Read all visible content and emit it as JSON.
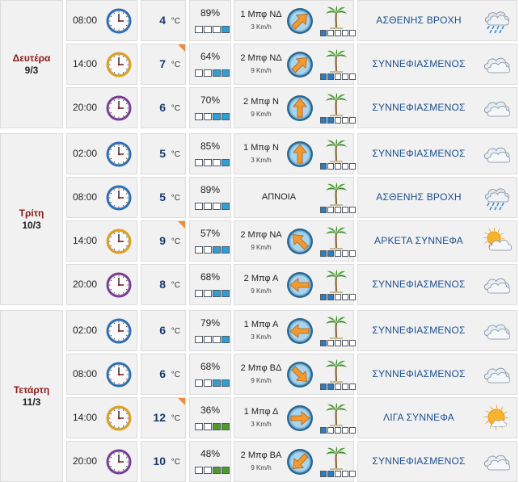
{
  "units": {
    "temp": "°C"
  },
  "days": [
    {
      "name": "Δευτέρα",
      "date": "9/3",
      "rows": [
        {
          "time": "08:00",
          "clock": "blue",
          "temp": "4",
          "hot": false,
          "humidity": "89%",
          "hum_level": 1,
          "hum_color": "blue",
          "wind": "1 Μπφ ΝΔ",
          "wind_speed": "3 Km/h",
          "wind_to_deg": 45,
          "calm": false,
          "palm_level": 1,
          "desc": "ΑΣΘΕΝΗΣ ΒΡΟΧΗ",
          "icon": "rain-cloud-icon"
        },
        {
          "time": "14:00",
          "clock": "gold",
          "temp": "7",
          "hot": true,
          "humidity": "64%",
          "hum_level": 2,
          "hum_color": "blue",
          "wind": "2 Μπφ ΝΔ",
          "wind_speed": "9 Km/h",
          "wind_to_deg": 45,
          "calm": false,
          "palm_level": 2,
          "desc": "ΣΥΝΝΕΦΙΑΣΜΕΝΟΣ",
          "icon": "cloud-icon"
        },
        {
          "time": "20:00",
          "clock": "purple",
          "temp": "6",
          "hot": false,
          "humidity": "70%",
          "hum_level": 2,
          "hum_color": "blue",
          "wind": "2 Μπφ Ν",
          "wind_speed": "9 Km/h",
          "wind_to_deg": 0,
          "calm": false,
          "palm_level": 2,
          "desc": "ΣΥΝΝΕΦΙΑΣΜΕΝΟΣ",
          "icon": "cloud-icon"
        }
      ]
    },
    {
      "name": "Τρίτη",
      "date": "10/3",
      "rows": [
        {
          "time": "02:00",
          "clock": "blue",
          "temp": "5",
          "hot": false,
          "humidity": "85%",
          "hum_level": 1,
          "hum_color": "blue",
          "wind": "1 Μπφ Ν",
          "wind_speed": "3 Km/h",
          "wind_to_deg": 0,
          "calm": false,
          "palm_level": 1,
          "desc": "ΣΥΝΝΕΦΙΑΣΜΕΝΟΣ",
          "icon": "cloud-icon"
        },
        {
          "time": "08:00",
          "clock": "blue",
          "temp": "5",
          "hot": false,
          "humidity": "89%",
          "hum_level": 1,
          "hum_color": "blue",
          "wind": "ΑΠΝΟΙΑ",
          "wind_speed": "",
          "wind_to_deg": 0,
          "calm": true,
          "palm_level": 1,
          "desc": "ΑΣΘΕΝΗΣ ΒΡΟΧΗ",
          "icon": "rain-cloud-icon"
        },
        {
          "time": "14:00",
          "clock": "gold",
          "temp": "9",
          "hot": true,
          "humidity": "57%",
          "hum_level": 2,
          "hum_color": "blue",
          "wind": "2 Μπφ ΝΑ",
          "wind_speed": "9 Km/h",
          "wind_to_deg": 315,
          "calm": false,
          "palm_level": 2,
          "desc": "ΑΡΚΕΤΑ ΣΥΝΝΕΦΑ",
          "icon": "sun-cloud-icon"
        },
        {
          "time": "20:00",
          "clock": "purple",
          "temp": "8",
          "hot": false,
          "humidity": "68%",
          "hum_level": 2,
          "hum_color": "blue",
          "wind": "2 Μπφ Α",
          "wind_speed": "9 Km/h",
          "wind_to_deg": 270,
          "calm": false,
          "palm_level": 2,
          "desc": "ΣΥΝΝΕΦΙΑΣΜΕΝΟΣ",
          "icon": "cloud-icon"
        }
      ]
    },
    {
      "name": "Τετάρτη",
      "date": "11/3",
      "rows": [
        {
          "time": "02:00",
          "clock": "blue",
          "temp": "6",
          "hot": false,
          "humidity": "79%",
          "hum_level": 1,
          "hum_color": "blue",
          "wind": "1 Μπφ Α",
          "wind_speed": "3 Km/h",
          "wind_to_deg": 270,
          "calm": false,
          "palm_level": 1,
          "desc": "ΣΥΝΝΕΦΙΑΣΜΕΝΟΣ",
          "icon": "cloud-icon"
        },
        {
          "time": "08:00",
          "clock": "blue",
          "temp": "6",
          "hot": false,
          "humidity": "68%",
          "hum_level": 2,
          "hum_color": "blue",
          "wind": "2 Μπφ ΒΔ",
          "wind_speed": "9 Km/h",
          "wind_to_deg": 135,
          "calm": false,
          "palm_level": 2,
          "desc": "ΣΥΝΝΕΦΙΑΣΜΕΝΟΣ",
          "icon": "cloud-icon"
        },
        {
          "time": "14:00",
          "clock": "gold",
          "temp": "12",
          "hot": true,
          "humidity": "36%",
          "hum_level": 2,
          "hum_color": "green",
          "wind": "1 Μπφ Δ",
          "wind_speed": "3 Km/h",
          "wind_to_deg": 90,
          "calm": false,
          "palm_level": 1,
          "desc": "ΛΙΓΑ ΣΥΝΝΕΦΑ",
          "icon": "sun-small-cloud-icon"
        },
        {
          "time": "20:00",
          "clock": "purple",
          "temp": "10",
          "hot": false,
          "humidity": "48%",
          "hum_level": 2,
          "hum_color": "green",
          "wind": "2 Μπφ ΒΑ",
          "wind_speed": "9 Km/h",
          "wind_to_deg": 225,
          "calm": false,
          "palm_level": 2,
          "desc": "ΣΥΝΝΕΦΙΑΣΜΕΝΟΣ",
          "icon": "cloud-icon"
        }
      ]
    }
  ],
  "colors": {
    "clock_blue": "#2d6fb7",
    "clock_gold": "#e0a21c",
    "clock_purple": "#7a3c9a",
    "compass_ring": "#3a7fb0",
    "arrow": "#f29a2e",
    "humidity_blue": "#2f9fd6",
    "humidity_green": "#4e9a2b",
    "hot_flag": "#f08a3c",
    "day_name": "#8b1a1a",
    "desc_text": "#1b4e8e",
    "temp_text": "#1a3a6e"
  }
}
